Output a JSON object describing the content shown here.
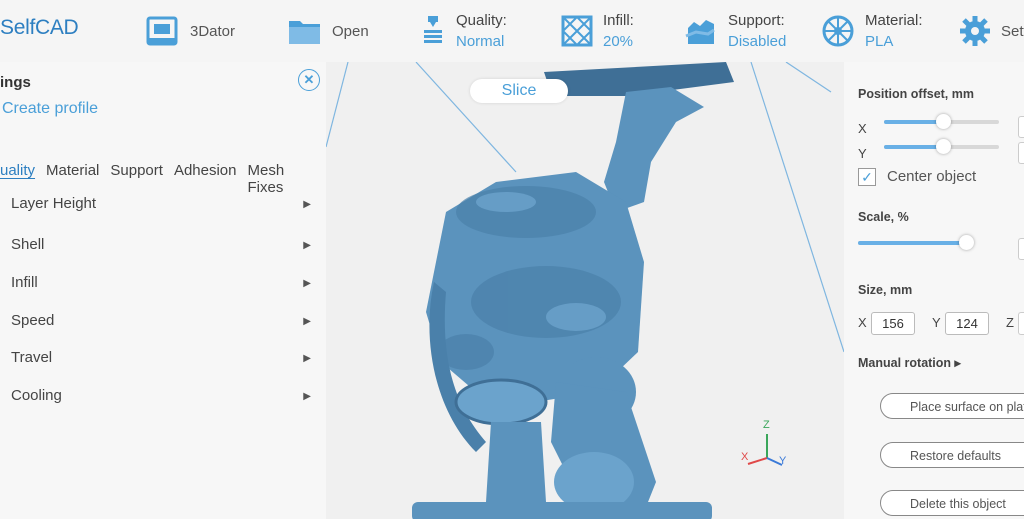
{
  "app": {
    "logo": "SelfCAD"
  },
  "toolbar": {
    "printer": {
      "label": "3Dator"
    },
    "open": {
      "label": "Open"
    },
    "quality": {
      "label": "Quality:",
      "value": "Normal"
    },
    "infill": {
      "label": "Infill:",
      "value": "20%"
    },
    "support": {
      "label": "Support:",
      "value": "Disabled"
    },
    "material": {
      "label": "Material:",
      "value": "PLA"
    },
    "settings": {
      "label": "Sett"
    }
  },
  "left_panel": {
    "title": "ings",
    "create_profile": "Create profile",
    "tabs": [
      "uality",
      "Material",
      "Support",
      "Adhesion",
      "Mesh Fixes"
    ],
    "sections": [
      "Layer Height",
      "Shell",
      "Infill",
      "Speed",
      "Travel",
      "Cooling"
    ]
  },
  "viewport": {
    "slice_label": "Slice",
    "axis_x": "X",
    "axis_y": "Y",
    "axis_z": "Z"
  },
  "right_panel": {
    "position_offset": {
      "title": "Position offset, mm",
      "x_label": "X",
      "y_label": "Y",
      "x_slider": 0.5,
      "y_slider": 0.5
    },
    "center_object": {
      "label": "Center object",
      "checked": true
    },
    "scale": {
      "title": "Scale, %",
      "slider": 0.93
    },
    "size": {
      "title": "Size, mm",
      "x_label": "X",
      "x_value": "156",
      "y_label": "Y",
      "y_value": "124",
      "z_label": "Z"
    },
    "manual_rotation": "Manual rotation ▸",
    "place_surface": "Place surface on plate",
    "restore_defaults": "Restore defaults",
    "delete_object": "Delete this object"
  },
  "colors": {
    "accent": "#4a9fd8",
    "model": "#5b93bd"
  }
}
